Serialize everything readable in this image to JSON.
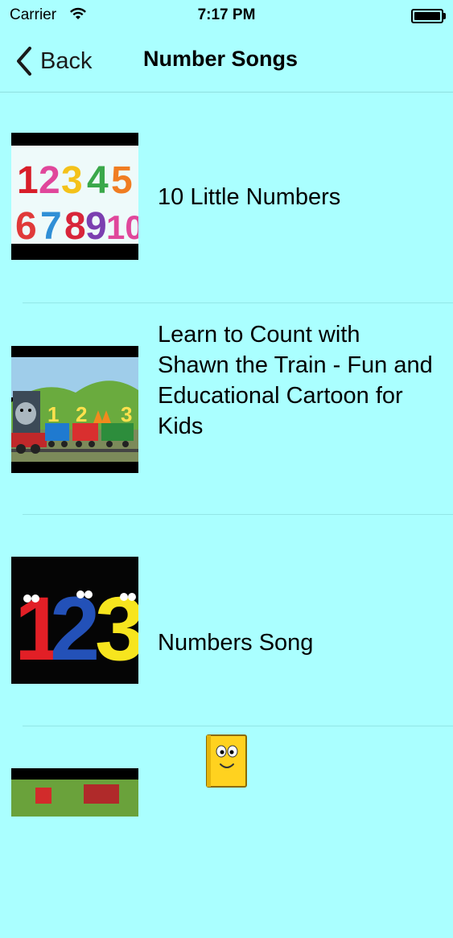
{
  "status_bar": {
    "carrier": "Carrier",
    "time": "7:17 PM"
  },
  "nav": {
    "back_label": "Back",
    "title": "Number Songs"
  },
  "songs": [
    {
      "title": "10 Little Numbers"
    },
    {
      "title": "Learn to Count with Shawn the Train  -  Fun and Educational Cartoon for Kids"
    },
    {
      "title": "Numbers Song"
    }
  ],
  "thumbnail_text": {
    "numbers_row1": [
      "1",
      "2",
      "3",
      "4",
      "5"
    ],
    "numbers_row2": [
      "6",
      "7",
      "8",
      "9",
      "10"
    ],
    "train_numbers": [
      "1",
      "2",
      "3"
    ],
    "big_numbers": [
      "1",
      "2",
      "3"
    ]
  },
  "colors": {
    "background": "#aaffff",
    "separator": "#93e6e6"
  }
}
